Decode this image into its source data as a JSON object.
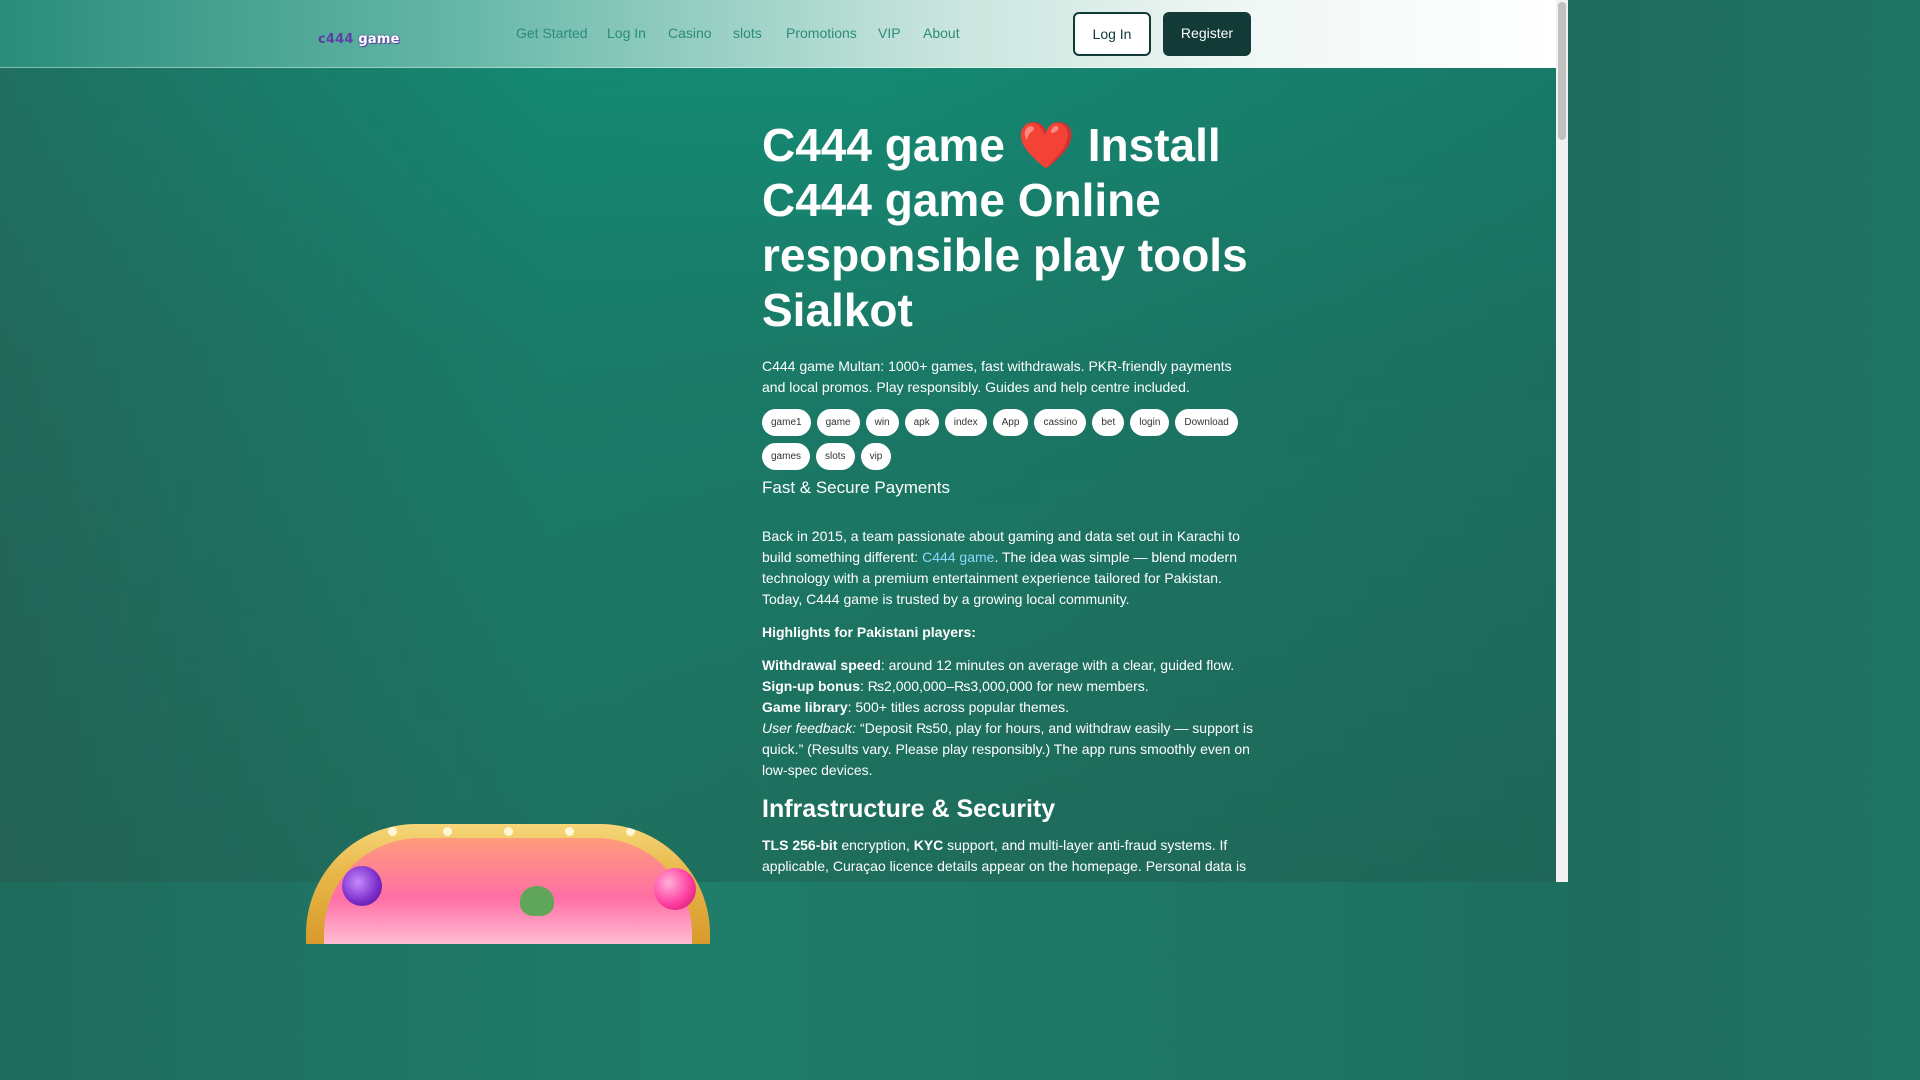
{
  "header": {
    "logo": {
      "prefix": "c444",
      "suffix": " game"
    },
    "nav": [
      "Get Started",
      "Log In",
      "Casino",
      "slots",
      "Promotions",
      "VIP",
      "About"
    ],
    "login_label": "Log In",
    "register_label": "Register"
  },
  "hero": {
    "title_part1": "C444 game ",
    "heart": "❤️",
    "title_part2": " Install C444 game Online responsible play tools Sialkot",
    "description": "C444 game Multan: 1000+ games, fast withdrawals. PKR-friendly payments and local promos. Play responsibly. Guides and help centre included.",
    "tags": [
      "game1",
      "game",
      "win",
      "apk",
      "index",
      "App",
      "cassino",
      "bet",
      "login",
      "Download",
      "games",
      "slots",
      "vip"
    ],
    "subtitle": "Fast & Secure Payments"
  },
  "body": {
    "intro_before": "Back in 2015, a team passionate about gaming and data set out in Karachi to build something different: ",
    "intro_link": "C444 game",
    "intro_after": ". The idea was simple — blend modern technology with a premium entertainment experience tailored for Pakistan. Today, C444 game is trusted by a growing local community.",
    "highlights_heading": "Highlights for Pakistani players:",
    "withdrawal_label": "Withdrawal speed",
    "withdrawal_text": ": around 12 minutes on average with a clear, guided flow.",
    "bonus_label": "Sign-up bonus",
    "bonus_text": ": ₨2,000,000–₨3,000,000 for new members.",
    "library_label": "Game library",
    "library_text": ": 500+ titles across popular themes.",
    "feedback_label": "User feedback:",
    "feedback_text": " “Deposit ₨50, play for hours, and withdraw easily — support is quick.” (Results vary. Please play responsibly.) The app runs smoothly even on low-spec devices.",
    "security_heading": "Infrastructure & Security",
    "security_tls": "TLS 256-bit",
    "security_mid1": " encryption, ",
    "security_kyc": "KYC",
    "security_rest": " support, and multi-layer anti-fraud systems. If applicable, Curaçao licence details appear on the homepage. Personal data is"
  },
  "colors": {
    "accent": "#2a8c7a",
    "button_dark": "#123a37",
    "link": "#8fd7ff",
    "heart": "#e01f2e"
  }
}
